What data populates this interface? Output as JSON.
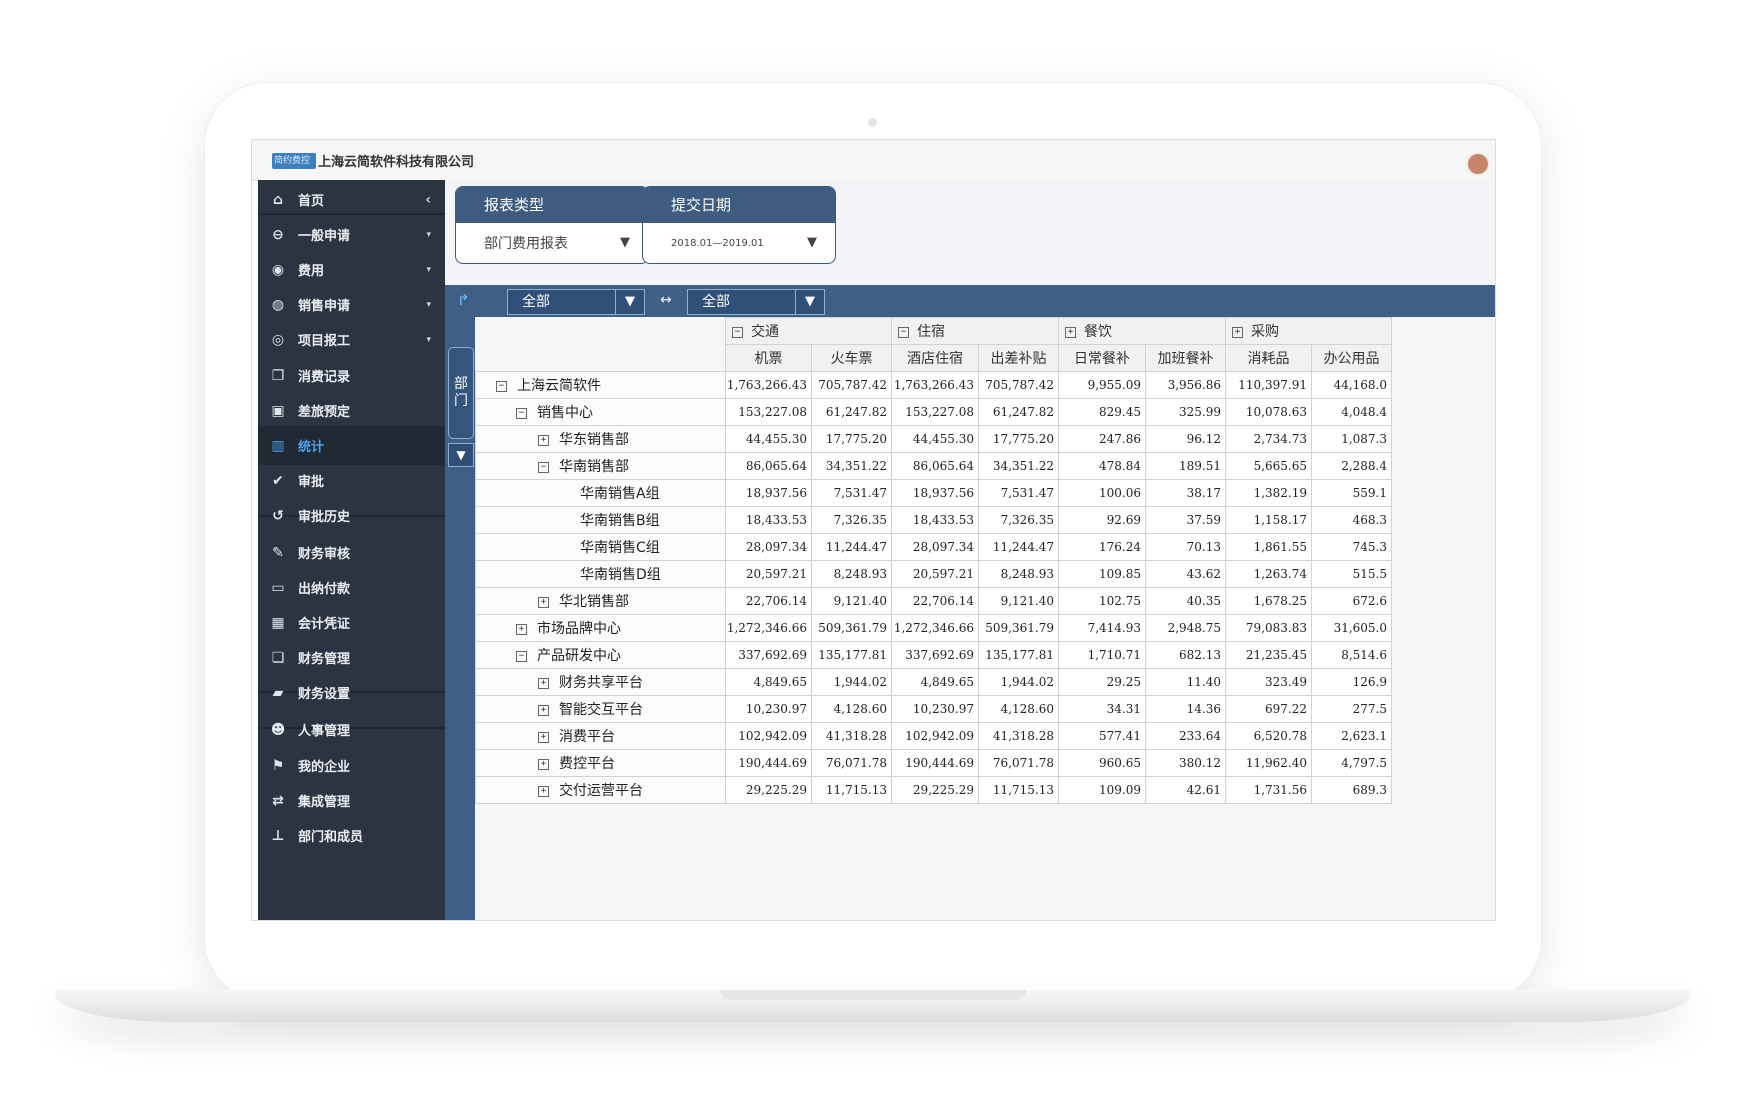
{
  "app": {
    "logo_text": "简约费控",
    "company": "上海云简软件科技有限公司"
  },
  "sidebar": {
    "items": [
      {
        "label": "首页",
        "icon": "home-icon",
        "glyph": "⌂",
        "caret": "‹"
      },
      {
        "label": "一般申请",
        "icon": "minus-circle-icon",
        "glyph": "⊖",
        "caret": "▾"
      },
      {
        "label": "费用",
        "icon": "coins-icon",
        "glyph": "◉",
        "caret": "▾"
      },
      {
        "label": "销售申请",
        "icon": "globe-icon",
        "glyph": "◍",
        "caret": "▾"
      },
      {
        "label": "项目报工",
        "icon": "settings-icon",
        "glyph": "◎",
        "caret": "▾"
      },
      {
        "label": "消费记录",
        "icon": "copy-icon",
        "glyph": "❐",
        "caret": ""
      },
      {
        "label": "差旅预定",
        "icon": "briefcase-icon",
        "glyph": "▣",
        "caret": ""
      },
      {
        "label": "统计",
        "icon": "bar-chart-icon",
        "glyph": "▥",
        "caret": ""
      },
      {
        "label": "审批",
        "icon": "check-circle-icon",
        "glyph": "✔",
        "caret": ""
      },
      {
        "label": "审批历史",
        "icon": "history-icon",
        "glyph": "↺",
        "caret": ""
      },
      {
        "label": "财务审核",
        "icon": "edit-icon",
        "glyph": "✎",
        "caret": ""
      },
      {
        "label": "出纳付款",
        "icon": "money-icon",
        "glyph": "▭",
        "caret": ""
      },
      {
        "label": "会计凭证",
        "icon": "calculator-icon",
        "glyph": "▦",
        "caret": ""
      },
      {
        "label": "财务管理",
        "icon": "files-icon",
        "glyph": "❏",
        "caret": ""
      },
      {
        "label": "财务设置",
        "icon": "book-icon",
        "glyph": "▰",
        "caret": ""
      },
      {
        "label": "人事管理",
        "icon": "users-icon",
        "glyph": "☻",
        "caret": ""
      },
      {
        "label": "我的企业",
        "icon": "flag-icon",
        "glyph": "⚑",
        "caret": ""
      },
      {
        "label": "集成管理",
        "icon": "sync-icon",
        "glyph": "⇄",
        "caret": ""
      },
      {
        "label": "部门和成员",
        "icon": "sitemap-icon",
        "glyph": "⊥",
        "caret": ""
      }
    ],
    "active_index": 7
  },
  "filters": {
    "report_type": {
      "title": "报表类型",
      "value": "部门费用报表"
    },
    "submit_date": {
      "title": "提交日期",
      "value": "2018.01—2019.01"
    }
  },
  "toolbar": {
    "select1": "全部",
    "select2": "全部",
    "swap_symbol": "↔",
    "filter_glyph": "▼",
    "pivot_glyph": "↱"
  },
  "row_dimension": {
    "label": "部门"
  },
  "table": {
    "groups": [
      {
        "label": "交通",
        "toggle": "−"
      },
      {
        "label": "住宿",
        "toggle": "−"
      },
      {
        "label": "餐饮",
        "toggle": "+"
      },
      {
        "label": "采购",
        "toggle": "+"
      }
    ],
    "columns": [
      "机票",
      "火车票",
      "酒店住宿",
      "出差补贴",
      "日常餐补",
      "加班餐补",
      "消耗品",
      "办公用品"
    ],
    "rows": [
      {
        "label": "上海云简软件",
        "level": 0,
        "toggle": "−",
        "values": [
          "1,763,266.43",
          "705,787.42",
          "1,763,266.43",
          "705,787.42",
          "9,955.09",
          "3,956.86",
          "110,397.91",
          "44,168.0"
        ]
      },
      {
        "label": "销售中心",
        "level": 1,
        "toggle": "−",
        "values": [
          "153,227.08",
          "61,247.82",
          "153,227.08",
          "61,247.82",
          "829.45",
          "325.99",
          "10,078.63",
          "4,048.4"
        ]
      },
      {
        "label": "华东销售部",
        "level": 2,
        "toggle": "+",
        "values": [
          "44,455.30",
          "17,775.20",
          "44,455.30",
          "17,775.20",
          "247.86",
          "96.12",
          "2,734.73",
          "1,087.3"
        ]
      },
      {
        "label": "华南销售部",
        "level": 2,
        "toggle": "−",
        "values": [
          "86,065.64",
          "34,351.22",
          "86,065.64",
          "34,351.22",
          "478.84",
          "189.51",
          "5,665.65",
          "2,288.4"
        ]
      },
      {
        "label": "华南销售A组",
        "level": 3,
        "toggle": "",
        "values": [
          "18,937.56",
          "7,531.47",
          "18,937.56",
          "7,531.47",
          "100.06",
          "38.17",
          "1,382.19",
          "559.1"
        ]
      },
      {
        "label": "华南销售B组",
        "level": 3,
        "toggle": "",
        "values": [
          "18,433.53",
          "7,326.35",
          "18,433.53",
          "7,326.35",
          "92.69",
          "37.59",
          "1,158.17",
          "468.3"
        ]
      },
      {
        "label": "华南销售C组",
        "level": 3,
        "toggle": "",
        "values": [
          "28,097.34",
          "11,244.47",
          "28,097.34",
          "11,244.47",
          "176.24",
          "70.13",
          "1,861.55",
          "745.3"
        ]
      },
      {
        "label": "华南销售D组",
        "level": 3,
        "toggle": "",
        "values": [
          "20,597.21",
          "8,248.93",
          "20,597.21",
          "8,248.93",
          "109.85",
          "43.62",
          "1,263.74",
          "515.5"
        ]
      },
      {
        "label": "华北销售部",
        "level": 2,
        "toggle": "+",
        "values": [
          "22,706.14",
          "9,121.40",
          "22,706.14",
          "9,121.40",
          "102.75",
          "40.35",
          "1,678.25",
          "672.6"
        ]
      },
      {
        "label": "市场品牌中心",
        "level": 1,
        "toggle": "+",
        "values": [
          "1,272,346.66",
          "509,361.79",
          "1,272,346.66",
          "509,361.79",
          "7,414.93",
          "2,948.75",
          "79,083.83",
          "31,605.0"
        ]
      },
      {
        "label": "产品研发中心",
        "level": 1,
        "toggle": "−",
        "values": [
          "337,692.69",
          "135,177.81",
          "337,692.69",
          "135,177.81",
          "1,710.71",
          "682.13",
          "21,235.45",
          "8,514.6"
        ]
      },
      {
        "label": "财务共享平台",
        "level": 2,
        "toggle": "+",
        "values": [
          "4,849.65",
          "1,944.02",
          "4,849.65",
          "1,944.02",
          "29.25",
          "11.40",
          "323.49",
          "126.9"
        ]
      },
      {
        "label": "智能交互平台",
        "level": 2,
        "toggle": "+",
        "values": [
          "10,230.97",
          "4,128.60",
          "10,230.97",
          "4,128.60",
          "34.31",
          "14.36",
          "697.22",
          "277.5"
        ]
      },
      {
        "label": "消费平台",
        "level": 2,
        "toggle": "+",
        "values": [
          "102,942.09",
          "41,318.28",
          "102,942.09",
          "41,318.28",
          "577.41",
          "233.64",
          "6,520.78",
          "2,623.1"
        ]
      },
      {
        "label": "费控平台",
        "level": 2,
        "toggle": "+",
        "values": [
          "190,444.69",
          "76,071.78",
          "190,444.69",
          "76,071.78",
          "960.65",
          "380.12",
          "11,962.40",
          "4,797.5"
        ]
      },
      {
        "label": "交付运营平台",
        "level": 2,
        "toggle": "+",
        "values": [
          "29,225.29",
          "11,715.13",
          "29,225.29",
          "11,715.13",
          "109.09",
          "42.61",
          "1,731.56",
          "689.3"
        ]
      }
    ]
  }
}
